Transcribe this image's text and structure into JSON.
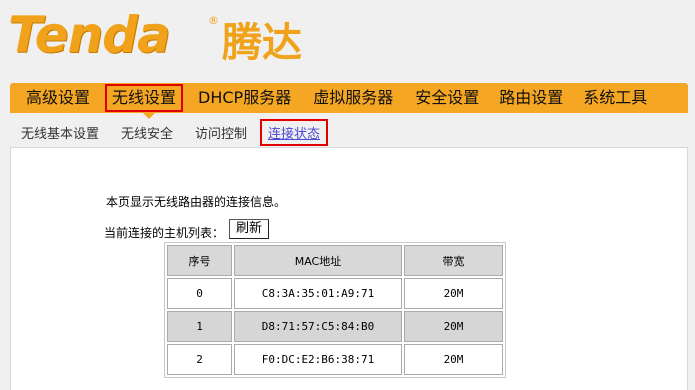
{
  "brand": {
    "name_en": "Tenda",
    "reg_mark": "®",
    "name_cn": "腾达"
  },
  "main_nav": [
    {
      "label": "高级设置"
    },
    {
      "label": "无线设置",
      "active": true
    },
    {
      "label": "DHCP服务器"
    },
    {
      "label": "虚拟服务器"
    },
    {
      "label": "安全设置"
    },
    {
      "label": "路由设置"
    },
    {
      "label": "系统工具"
    }
  ],
  "sub_nav": [
    {
      "label": "无线基本设置"
    },
    {
      "label": "无线安全"
    },
    {
      "label": "访问控制"
    },
    {
      "label": "连接状态",
      "active": true
    }
  ],
  "content": {
    "description": "本页显示无线路由器的连接信息。",
    "host_list_label": "当前连接的主机列表：",
    "refresh_label": "刷新"
  },
  "table": {
    "headers": [
      "序号",
      "MAC地址",
      "带宽"
    ],
    "rows": [
      [
        "0",
        "C8:3A:35:01:A9:71",
        "20M"
      ],
      [
        "1",
        "D8:71:57:C5:84:B0",
        "20M"
      ],
      [
        "2",
        "F0:DC:E2:B6:38:71",
        "20M"
      ]
    ]
  },
  "colors": {
    "nav_bg": "#f5a623",
    "brand": "#f0a21a",
    "highlight_box": "#e00000"
  }
}
